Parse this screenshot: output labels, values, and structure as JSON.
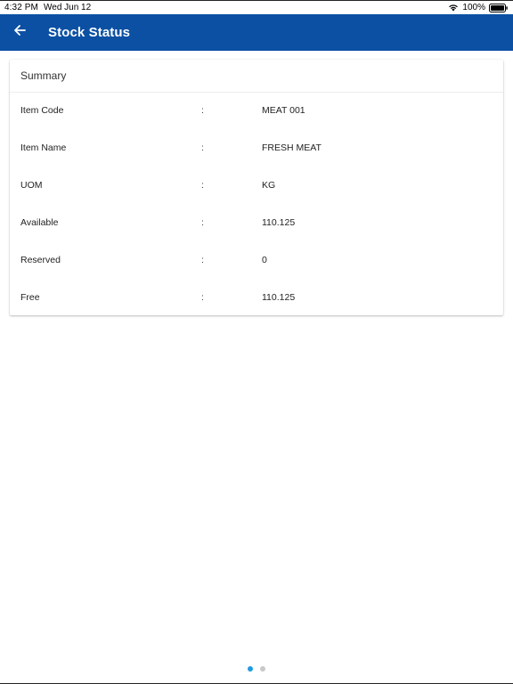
{
  "status_bar": {
    "time": "4:32 PM",
    "date": "Wed Jun 12",
    "battery": "100%",
    "icons": [
      "wifi-icon",
      "battery-icon"
    ]
  },
  "header": {
    "title": "Stock Status",
    "back_icon": "arrow-left-icon",
    "background_color": "#0c50a3"
  },
  "summary": {
    "title": "Summary",
    "separator": ":",
    "rows": [
      {
        "label": "Item Code",
        "value": "MEAT 001"
      },
      {
        "label": "Item Name",
        "value": "FRESH MEAT"
      },
      {
        "label": "UOM",
        "value": "KG"
      },
      {
        "label": "Available",
        "value": "110.125"
      },
      {
        "label": "Reserved",
        "value": "0"
      },
      {
        "label": "Free",
        "value": "110.125"
      }
    ]
  },
  "pager": {
    "pages": 2,
    "active_index": 0,
    "active_color": "#1f9be0",
    "inactive_color": "#c8c8c8"
  }
}
